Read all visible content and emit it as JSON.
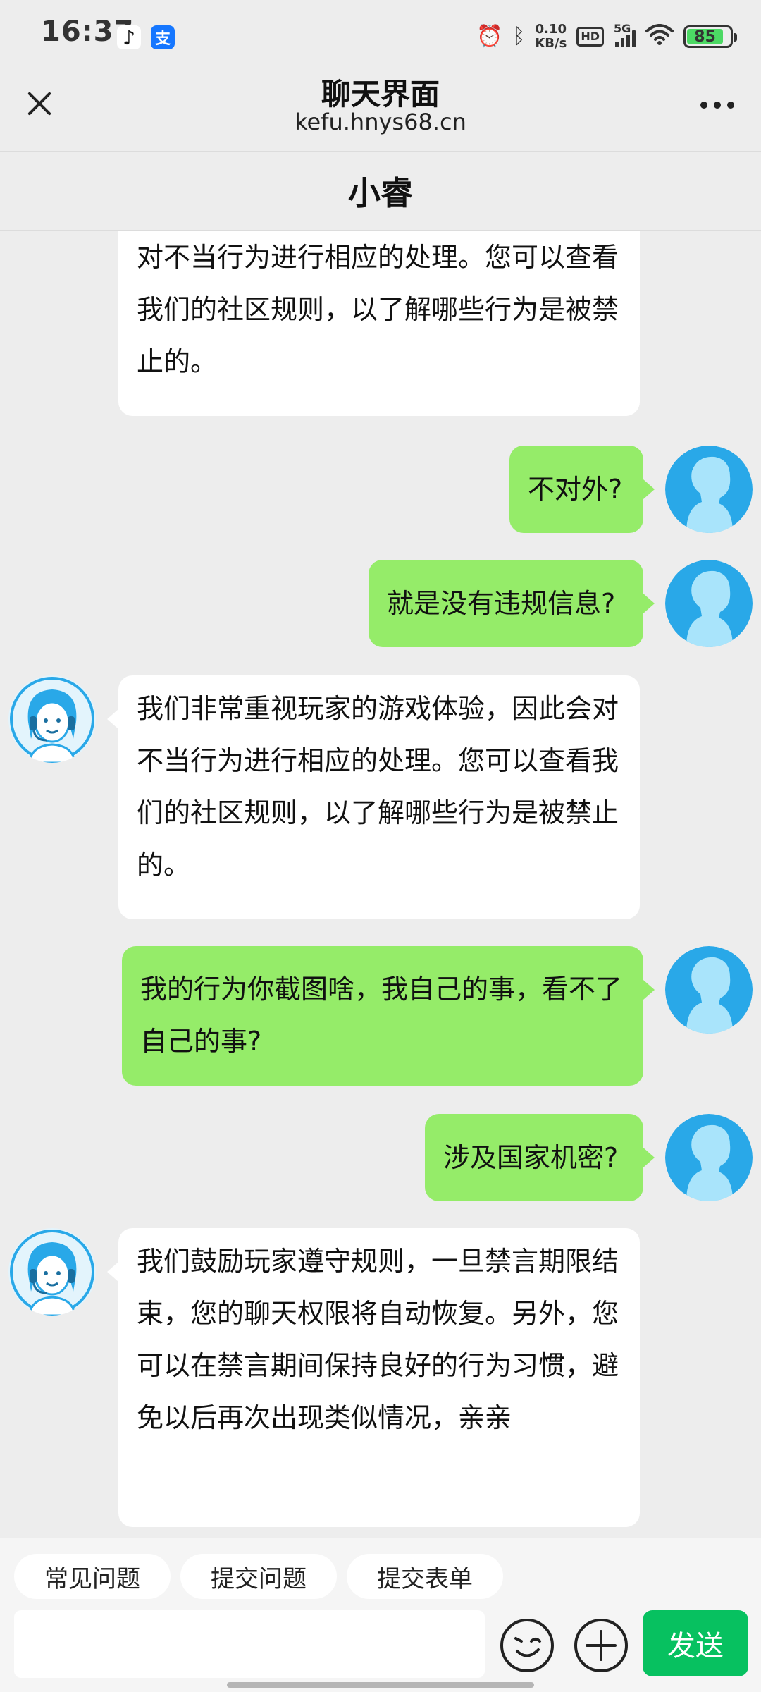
{
  "status_bar": {
    "time": "16:37",
    "network_speed_value": "0.10",
    "network_speed_unit": "KB/s",
    "hd_label": "HD",
    "network_type": "5G",
    "battery_level": "85"
  },
  "header": {
    "title": "聊天界面",
    "subtitle": "kefu.hnys68.cn"
  },
  "agent_name": "小睿",
  "messages": [
    {
      "sender": "agent",
      "text": "对不当行为进行相应的处理。您可以查看我们的社区规则，以了解哪些行为是被禁止的。"
    },
    {
      "sender": "user",
      "text": "不对外?"
    },
    {
      "sender": "user",
      "text": "就是没有违规信息?"
    },
    {
      "sender": "agent",
      "text": "我们非常重视玩家的游戏体验，因此会对不当行为进行相应的处理。您可以查看我们的社区规则，以了解哪些行为是被禁止的。"
    },
    {
      "sender": "user",
      "text": "我的行为你截图啥，我自己的事，看不了自己的事?"
    },
    {
      "sender": "user",
      "text": "涉及国家机密?"
    },
    {
      "sender": "agent",
      "text": "我们鼓励玩家遵守规则，一旦禁言期限结束，您的聊天权限将自动恢复。另外，您可以在禁言期间保持良好的行为习惯，避免以后再次出现类似情况，亲亲"
    }
  ],
  "quick_actions": [
    "常见问题",
    "提交问题",
    "提交表单"
  ],
  "input": {
    "value": "",
    "send_label": "发送"
  },
  "colors": {
    "user_bubble": "#95ec69",
    "agent_bubble": "#ffffff",
    "send_button": "#07c160",
    "background": "#ededed"
  }
}
